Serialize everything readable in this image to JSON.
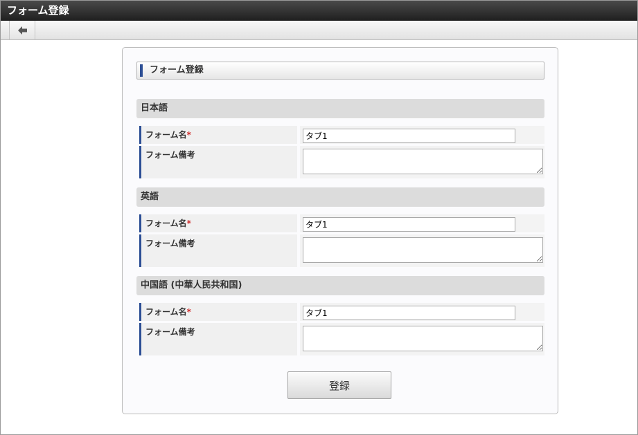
{
  "window": {
    "title": "フォーム登録"
  },
  "toolbar": {
    "back_icon": "arrow-left-icon"
  },
  "form": {
    "title": "フォーム登録",
    "required_mark": "*",
    "sections": [
      {
        "heading": "日本語",
        "name_label": "フォーム名",
        "name_value": "タブ1",
        "note_label": "フォーム備考",
        "note_value": ""
      },
      {
        "heading": "英語",
        "name_label": "フォーム名",
        "name_value": "タブ1",
        "note_label": "フォーム備考",
        "note_value": ""
      },
      {
        "heading": "中国語 (中華人民共和国)",
        "name_label": "フォーム名",
        "name_value": "タブ1",
        "note_label": "フォーム備考",
        "note_value": ""
      }
    ],
    "submit_label": "登録"
  },
  "colors": {
    "accent_bar": "#2d4f95",
    "required": "#d0302f",
    "titlebar": "#2b2b2b"
  }
}
